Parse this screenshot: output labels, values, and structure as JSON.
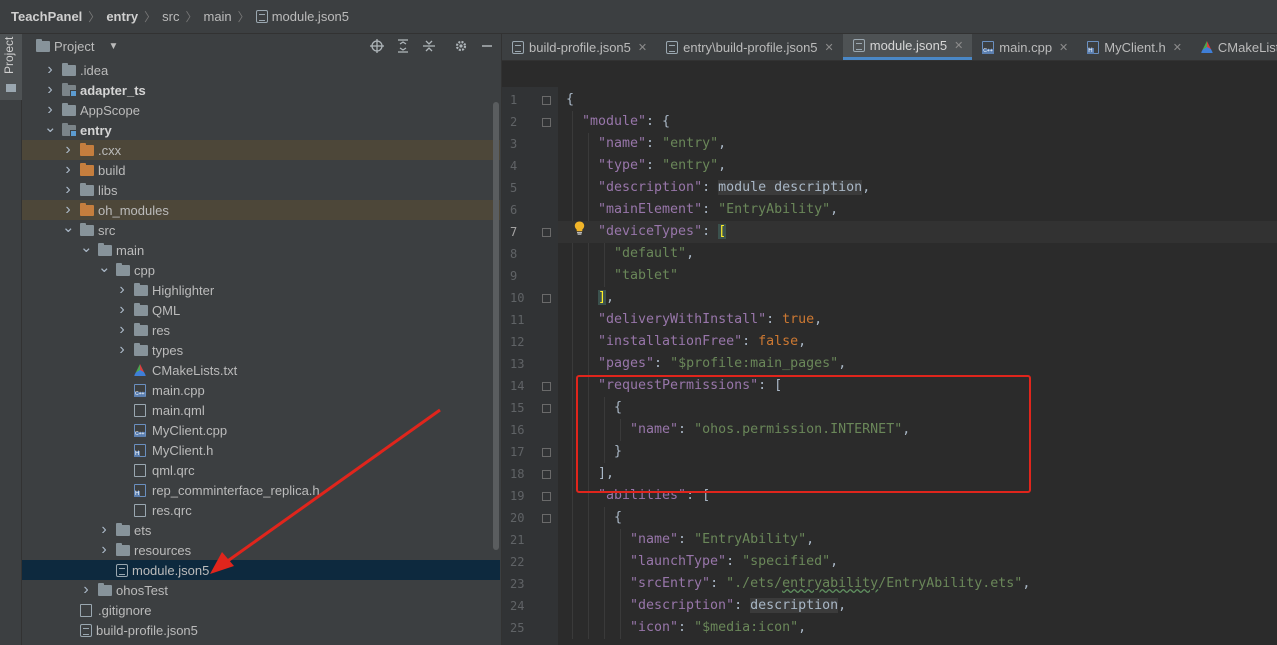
{
  "breadcrumb": {
    "items": [
      {
        "label": "TeachPanel",
        "bold": true
      },
      {
        "label": "entry",
        "bold": true
      },
      {
        "label": "src",
        "bold": false
      },
      {
        "label": "main",
        "bold": false
      },
      {
        "label": "module.json5",
        "bold": false,
        "icon": "json-file-icon"
      }
    ]
  },
  "tool_strip": {
    "project_tab": "Project"
  },
  "project_panel": {
    "title": "Project",
    "header_icons": [
      "locate-icon",
      "expand-all-icon",
      "collapse-all-icon",
      "gear-icon",
      "minimize-icon"
    ],
    "tree": [
      {
        "label": ".idea",
        "depth": 1,
        "expander": "right",
        "icon": "folder",
        "state": ""
      },
      {
        "label": "adapter_ts",
        "depth": 1,
        "expander": "right",
        "icon": "module",
        "state": "bold"
      },
      {
        "label": "AppScope",
        "depth": 1,
        "expander": "right",
        "icon": "folder",
        "state": ""
      },
      {
        "label": "entry",
        "depth": 1,
        "expander": "down",
        "icon": "module",
        "state": "bold"
      },
      {
        "label": ".cxx",
        "depth": 2,
        "expander": "right",
        "icon": "orange",
        "state": "excluded"
      },
      {
        "label": "build",
        "depth": 2,
        "expander": "right",
        "icon": "orange",
        "state": ""
      },
      {
        "label": "libs",
        "depth": 2,
        "expander": "right",
        "icon": "folder",
        "state": ""
      },
      {
        "label": "oh_modules",
        "depth": 2,
        "expander": "right",
        "icon": "orange",
        "state": "excluded"
      },
      {
        "label": "src",
        "depth": 2,
        "expander": "down",
        "icon": "folder",
        "state": ""
      },
      {
        "label": "main",
        "depth": 3,
        "expander": "down",
        "icon": "folder",
        "state": ""
      },
      {
        "label": "cpp",
        "depth": 4,
        "expander": "down",
        "icon": "folder",
        "state": ""
      },
      {
        "label": "Highlighter",
        "depth": 5,
        "expander": "right",
        "icon": "folder",
        "state": ""
      },
      {
        "label": "QML",
        "depth": 5,
        "expander": "right",
        "icon": "folder",
        "state": ""
      },
      {
        "label": "res",
        "depth": 5,
        "expander": "right",
        "icon": "folder",
        "state": ""
      },
      {
        "label": "types",
        "depth": 5,
        "expander": "right",
        "icon": "folder",
        "state": ""
      },
      {
        "label": "CMakeLists.txt",
        "depth": 5,
        "expander": "none",
        "icon": "cmake",
        "state": ""
      },
      {
        "label": "main.cpp",
        "depth": 5,
        "expander": "none",
        "icon": "cpp",
        "state": ""
      },
      {
        "label": "main.qml",
        "depth": 5,
        "expander": "none",
        "icon": "file",
        "state": ""
      },
      {
        "label": "MyClient.cpp",
        "depth": 5,
        "expander": "none",
        "icon": "cpp",
        "state": ""
      },
      {
        "label": "MyClient.h",
        "depth": 5,
        "expander": "none",
        "icon": "h",
        "state": ""
      },
      {
        "label": "qml.qrc",
        "depth": 5,
        "expander": "none",
        "icon": "file",
        "state": ""
      },
      {
        "label": "rep_comminterface_replica.h",
        "depth": 5,
        "expander": "none",
        "icon": "h",
        "state": ""
      },
      {
        "label": "res.qrc",
        "depth": 5,
        "expander": "none",
        "icon": "file",
        "state": ""
      },
      {
        "label": "ets",
        "depth": 4,
        "expander": "right",
        "icon": "folder",
        "state": ""
      },
      {
        "label": "resources",
        "depth": 4,
        "expander": "right",
        "icon": "folder",
        "state": ""
      },
      {
        "label": "module.json5",
        "depth": 4,
        "expander": "none",
        "icon": "json",
        "state": "selected"
      },
      {
        "label": "ohosTest",
        "depth": 3,
        "expander": "right",
        "icon": "folder",
        "state": ""
      },
      {
        "label": ".gitignore",
        "depth": 2,
        "expander": "none",
        "icon": "file",
        "state": ""
      },
      {
        "label": "build-profile.json5",
        "depth": 2,
        "expander": "none",
        "icon": "json",
        "state": ""
      }
    ]
  },
  "editor": {
    "tabs": [
      {
        "label": "build-profile.json5",
        "icon": "json",
        "active": false,
        "closable": true
      },
      {
        "label": "entry\\build-profile.json5",
        "icon": "json",
        "active": false,
        "closable": true
      },
      {
        "label": "module.json5",
        "icon": "json",
        "active": true,
        "closable": true
      },
      {
        "label": "main.cpp",
        "icon": "cpp",
        "active": false,
        "closable": true
      },
      {
        "label": "MyClient.h",
        "icon": "h",
        "active": false,
        "closable": true
      },
      {
        "label": "CMakeLists",
        "icon": "cmake",
        "active": false,
        "closable": false
      }
    ],
    "current_line": 7,
    "lines": [
      {
        "n": "1",
        "indent": 0,
        "tokens": [
          [
            "p",
            "{"
          ]
        ]
      },
      {
        "n": "2",
        "indent": 1,
        "tokens": [
          [
            "k",
            "\"module\""
          ],
          [
            "p",
            ": {"
          ]
        ]
      },
      {
        "n": "3",
        "indent": 2,
        "tokens": [
          [
            "k",
            "\"name\""
          ],
          [
            "p",
            ": "
          ],
          [
            "s",
            "\"entry\""
          ],
          [
            "p",
            ","
          ]
        ]
      },
      {
        "n": "4",
        "indent": 2,
        "tokens": [
          [
            "k",
            "\"type\""
          ],
          [
            "p",
            ": "
          ],
          [
            "s",
            "\"entry\""
          ],
          [
            "p",
            ","
          ]
        ]
      },
      {
        "n": "5",
        "indent": 2,
        "tokens": [
          [
            "k",
            "\"description\""
          ],
          [
            "p",
            ": "
          ],
          [
            "hl-plain",
            "module description"
          ],
          [
            "p",
            ","
          ]
        ]
      },
      {
        "n": "6",
        "indent": 2,
        "tokens": [
          [
            "k",
            "\"mainElement\""
          ],
          [
            "p",
            ": "
          ],
          [
            "s",
            "\"EntryAbility\""
          ],
          [
            "p",
            ","
          ]
        ]
      },
      {
        "n": "7",
        "indent": 2,
        "tokens": [
          [
            "k",
            "\"deviceTypes\""
          ],
          [
            "p",
            ": "
          ],
          [
            "bracket-hl",
            "["
          ]
        ]
      },
      {
        "n": "8",
        "indent": 3,
        "tokens": [
          [
            "s",
            "\"default\""
          ],
          [
            "p",
            ","
          ]
        ]
      },
      {
        "n": "9",
        "indent": 3,
        "tokens": [
          [
            "s",
            "\"tablet\""
          ]
        ]
      },
      {
        "n": "10",
        "indent": 2,
        "tokens": [
          [
            "bracket-hl",
            "]"
          ],
          [
            "p",
            ","
          ]
        ]
      },
      {
        "n": "11",
        "indent": 2,
        "tokens": [
          [
            "k",
            "\"deliveryWithInstall\""
          ],
          [
            "p",
            ": "
          ],
          [
            "kw",
            "true"
          ],
          [
            "p",
            ","
          ]
        ]
      },
      {
        "n": "12",
        "indent": 2,
        "tokens": [
          [
            "k",
            "\"installationFree\""
          ],
          [
            "p",
            ": "
          ],
          [
            "kw",
            "false"
          ],
          [
            "p",
            ","
          ]
        ]
      },
      {
        "n": "13",
        "indent": 2,
        "tokens": [
          [
            "k",
            "\"pages\""
          ],
          [
            "p",
            ": "
          ],
          [
            "s",
            "\"$profile:main_pages\""
          ],
          [
            "p",
            ","
          ]
        ]
      },
      {
        "n": "14",
        "indent": 2,
        "tokens": [
          [
            "k",
            "\"requestPermissions\""
          ],
          [
            "p",
            ": ["
          ]
        ]
      },
      {
        "n": "15",
        "indent": 3,
        "tokens": [
          [
            "p",
            "{"
          ]
        ]
      },
      {
        "n": "16",
        "indent": 4,
        "tokens": [
          [
            "k",
            "\"name\""
          ],
          [
            "p",
            ": "
          ],
          [
            "s",
            "\"ohos.permission.INTERNET\""
          ],
          [
            "p",
            ","
          ]
        ]
      },
      {
        "n": "17",
        "indent": 3,
        "tokens": [
          [
            "p",
            "}"
          ]
        ]
      },
      {
        "n": "18",
        "indent": 2,
        "tokens": [
          [
            "p",
            "],"
          ]
        ]
      },
      {
        "n": "19",
        "indent": 2,
        "tokens": [
          [
            "k",
            "\"abilities\""
          ],
          [
            "p",
            ": ["
          ]
        ]
      },
      {
        "n": "20",
        "indent": 3,
        "tokens": [
          [
            "p",
            "{"
          ]
        ]
      },
      {
        "n": "21",
        "indent": 4,
        "tokens": [
          [
            "k",
            "\"name\""
          ],
          [
            "p",
            ": "
          ],
          [
            "s",
            "\"EntryAbility\""
          ],
          [
            "p",
            ","
          ]
        ]
      },
      {
        "n": "22",
        "indent": 4,
        "tokens": [
          [
            "k",
            "\"launchType\""
          ],
          [
            "p",
            ": "
          ],
          [
            "s",
            "\"specified\""
          ],
          [
            "p",
            ","
          ]
        ]
      },
      {
        "n": "23",
        "indent": 4,
        "tokens": [
          [
            "k",
            "\"srcEntry\""
          ],
          [
            "p",
            ": "
          ],
          [
            "s",
            "\"./ets/"
          ],
          [
            "s-u",
            "entryability"
          ],
          [
            "s",
            "/EntryAbility.ets\""
          ],
          [
            "p",
            ","
          ]
        ]
      },
      {
        "n": "24",
        "indent": 4,
        "tokens": [
          [
            "k",
            "\"description\""
          ],
          [
            "p",
            ": "
          ],
          [
            "hl-plain",
            "description"
          ],
          [
            "p",
            ","
          ]
        ]
      },
      {
        "n": "25",
        "indent": 4,
        "tokens": [
          [
            "k",
            "\"icon\""
          ],
          [
            "p",
            ": "
          ],
          [
            "s",
            "\"$media:icon\""
          ],
          [
            "p",
            ","
          ]
        ]
      }
    ]
  },
  "annotation": {
    "box_color": "#e0251c",
    "arrow_color": "#e0251c"
  }
}
